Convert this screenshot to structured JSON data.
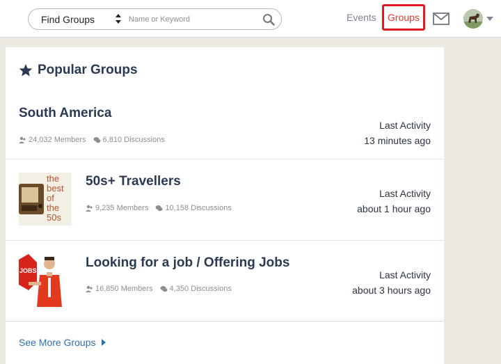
{
  "header": {
    "search": {
      "select_label": "Find Groups",
      "placeholder": "Name or Keyword"
    },
    "nav": {
      "events": "Events",
      "groups": "Groups"
    },
    "colors": {
      "active_nav": "#e03a2f",
      "highlight_box": "#e01a22"
    }
  },
  "panel": {
    "title": "Popular Groups",
    "groups": [
      {
        "name": "South America",
        "members": "24,032 Members",
        "discussions": "6,810 Discussions",
        "activity_label": "Last Activity",
        "activity_time": "13 minutes ago"
      },
      {
        "name": "50s+ Travellers",
        "members": "9,235 Members",
        "discussions": "10,158 Discussions",
        "activity_label": "Last Activity",
        "activity_time": "about 1 hour ago",
        "thumb_text": [
          "the",
          "best",
          "of",
          "the",
          "50s"
        ]
      },
      {
        "name": "Looking for a job / Offering Jobs",
        "members": "16,850 Members",
        "discussions": "4,350 Discussions",
        "activity_label": "Last Activity",
        "activity_time": "about 3 hours ago",
        "thumb_text": "JOBS"
      }
    ],
    "see_more": "See More Groups"
  }
}
